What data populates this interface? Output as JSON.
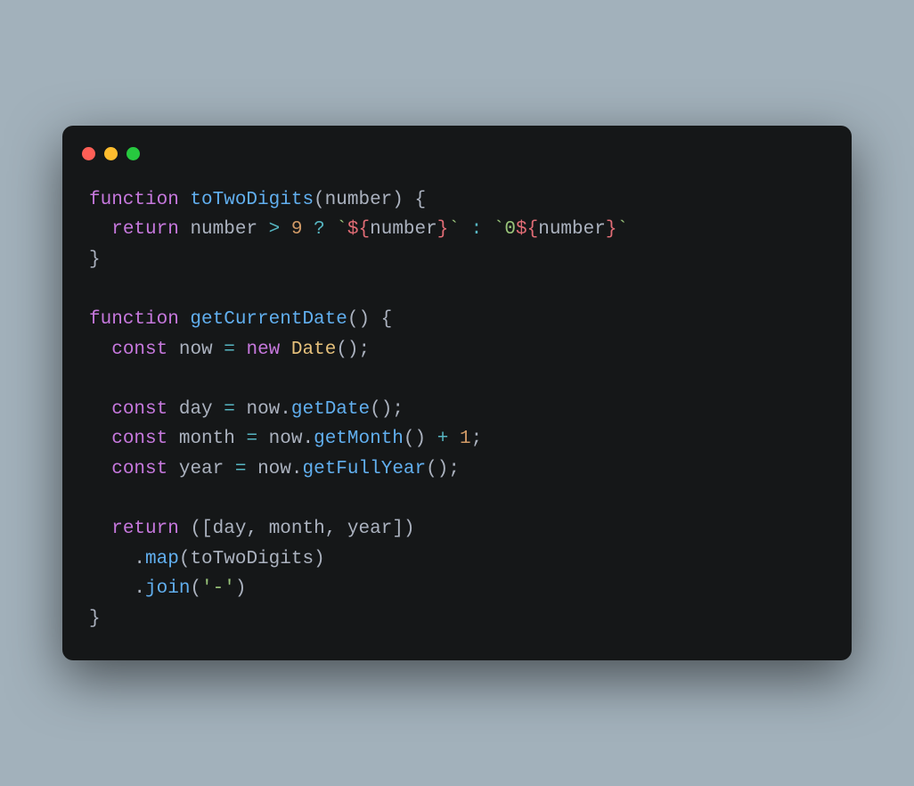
{
  "window": {
    "traffic_lights": [
      "close",
      "minimize",
      "maximize"
    ]
  },
  "colors": {
    "background_page": "#a2b1bb",
    "background_window": "#151718",
    "close": "#ff5f56",
    "minimize": "#ffbd2e",
    "maximize": "#27c93f",
    "keyword": "#c678dd",
    "function": "#61afef",
    "identifier": "#abb2bf",
    "number": "#d19a66",
    "string": "#98c379",
    "operator": "#56b6c2",
    "class": "#e5c07b",
    "interp": "#e06c75"
  },
  "code": {
    "language": "javascript",
    "tokens": [
      {
        "text": "function ",
        "type": "kw"
      },
      {
        "text": "toTwoDigits",
        "type": "fn"
      },
      {
        "text": "(",
        "type": "punct"
      },
      {
        "text": "number",
        "type": "param"
      },
      {
        "text": ") {",
        "type": "punct"
      },
      {
        "text": "\n",
        "type": "nl"
      },
      {
        "text": "  ",
        "type": "punct"
      },
      {
        "text": "return ",
        "type": "kw"
      },
      {
        "text": "number",
        "type": "param"
      },
      {
        "text": " > ",
        "type": "op"
      },
      {
        "text": "9",
        "type": "num"
      },
      {
        "text": " ? ",
        "type": "op"
      },
      {
        "text": "`",
        "type": "str"
      },
      {
        "text": "${",
        "type": "interp"
      },
      {
        "text": "number",
        "type": "param"
      },
      {
        "text": "}",
        "type": "interp"
      },
      {
        "text": "`",
        "type": "str"
      },
      {
        "text": " : ",
        "type": "op"
      },
      {
        "text": "`",
        "type": "str"
      },
      {
        "text": "0",
        "type": "str"
      },
      {
        "text": "${",
        "type": "interp"
      },
      {
        "text": "number",
        "type": "param"
      },
      {
        "text": "}",
        "type": "interp"
      },
      {
        "text": "`",
        "type": "str"
      },
      {
        "text": "\n",
        "type": "nl"
      },
      {
        "text": "}",
        "type": "punct"
      },
      {
        "text": "\n",
        "type": "nl"
      },
      {
        "text": "\n",
        "type": "nl"
      },
      {
        "text": "function ",
        "type": "kw"
      },
      {
        "text": "getCurrentDate",
        "type": "fn"
      },
      {
        "text": "() {",
        "type": "punct"
      },
      {
        "text": "\n",
        "type": "nl"
      },
      {
        "text": "  ",
        "type": "punct"
      },
      {
        "text": "const ",
        "type": "kw"
      },
      {
        "text": "now",
        "type": "param"
      },
      {
        "text": " = ",
        "type": "op"
      },
      {
        "text": "new ",
        "type": "kw"
      },
      {
        "text": "Date",
        "type": "cls"
      },
      {
        "text": "();",
        "type": "punct"
      },
      {
        "text": "\n",
        "type": "nl"
      },
      {
        "text": "\n",
        "type": "nl"
      },
      {
        "text": "  ",
        "type": "punct"
      },
      {
        "text": "const ",
        "type": "kw"
      },
      {
        "text": "day",
        "type": "param"
      },
      {
        "text": " = ",
        "type": "op"
      },
      {
        "text": "now",
        "type": "param"
      },
      {
        "text": ".",
        "type": "punct"
      },
      {
        "text": "getDate",
        "type": "fn"
      },
      {
        "text": "();",
        "type": "punct"
      },
      {
        "text": "\n",
        "type": "nl"
      },
      {
        "text": "  ",
        "type": "punct"
      },
      {
        "text": "const ",
        "type": "kw"
      },
      {
        "text": "month",
        "type": "param"
      },
      {
        "text": " = ",
        "type": "op"
      },
      {
        "text": "now",
        "type": "param"
      },
      {
        "text": ".",
        "type": "punct"
      },
      {
        "text": "getMonth",
        "type": "fn"
      },
      {
        "text": "()",
        "type": "punct"
      },
      {
        "text": " + ",
        "type": "op"
      },
      {
        "text": "1",
        "type": "num"
      },
      {
        "text": ";",
        "type": "punct"
      },
      {
        "text": "\n",
        "type": "nl"
      },
      {
        "text": "  ",
        "type": "punct"
      },
      {
        "text": "const ",
        "type": "kw"
      },
      {
        "text": "year",
        "type": "param"
      },
      {
        "text": " = ",
        "type": "op"
      },
      {
        "text": "now",
        "type": "param"
      },
      {
        "text": ".",
        "type": "punct"
      },
      {
        "text": "getFullYear",
        "type": "fn"
      },
      {
        "text": "();",
        "type": "punct"
      },
      {
        "text": "\n",
        "type": "nl"
      },
      {
        "text": "\n",
        "type": "nl"
      },
      {
        "text": "  ",
        "type": "punct"
      },
      {
        "text": "return ",
        "type": "kw"
      },
      {
        "text": "([",
        "type": "punct"
      },
      {
        "text": "day",
        "type": "param"
      },
      {
        "text": ", ",
        "type": "punct"
      },
      {
        "text": "month",
        "type": "param"
      },
      {
        "text": ", ",
        "type": "punct"
      },
      {
        "text": "year",
        "type": "param"
      },
      {
        "text": "])",
        "type": "punct"
      },
      {
        "text": "\n",
        "type": "nl"
      },
      {
        "text": "    .",
        "type": "punct"
      },
      {
        "text": "map",
        "type": "fn"
      },
      {
        "text": "(",
        "type": "punct"
      },
      {
        "text": "toTwoDigits",
        "type": "param"
      },
      {
        "text": ")",
        "type": "punct"
      },
      {
        "text": "\n",
        "type": "nl"
      },
      {
        "text": "    .",
        "type": "punct"
      },
      {
        "text": "join",
        "type": "fn"
      },
      {
        "text": "(",
        "type": "punct"
      },
      {
        "text": "'-'",
        "type": "str"
      },
      {
        "text": ")",
        "type": "punct"
      },
      {
        "text": "\n",
        "type": "nl"
      },
      {
        "text": "}",
        "type": "punct"
      }
    ]
  }
}
